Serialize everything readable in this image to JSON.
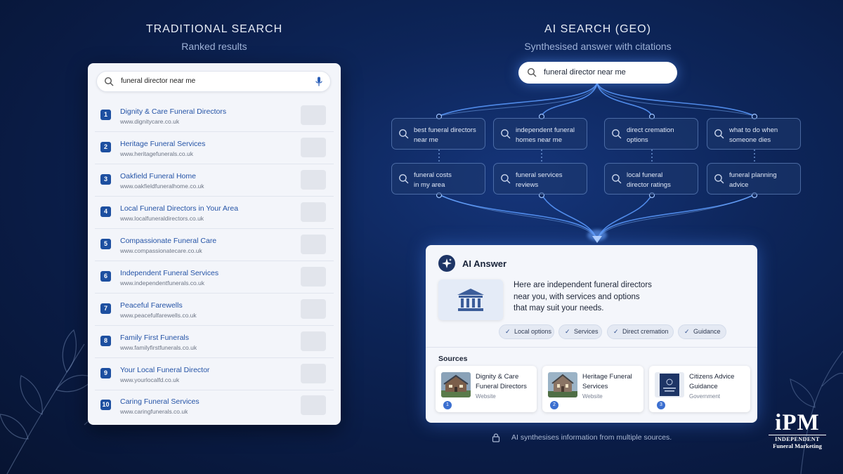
{
  "traditional": {
    "heading": "TRADITIONAL SEARCH",
    "subheading": "Ranked results",
    "search_query": "funeral director near me",
    "results": [
      {
        "rank": "1",
        "title": "Dignity & Care Funeral Directors",
        "url": "www.dignitycare.co.uk"
      },
      {
        "rank": "2",
        "title": "Heritage Funeral Services",
        "url": "www.heritagefunerals.co.uk"
      },
      {
        "rank": "3",
        "title": "Oakfield Funeral Home",
        "url": "www.oakfieldfuneralhome.co.uk"
      },
      {
        "rank": "4",
        "title": "Local Funeral Directors in Your Area",
        "url": "www.localfuneraldirectors.co.uk"
      },
      {
        "rank": "5",
        "title": "Compassionate Funeral Care",
        "url": "www.compassionatecare.co.uk"
      },
      {
        "rank": "6",
        "title": "Independent Funeral Services",
        "url": "www.independentfunerals.co.uk"
      },
      {
        "rank": "7",
        "title": "Peaceful Farewells",
        "url": "www.peacefulfarewells.co.uk"
      },
      {
        "rank": "8",
        "title": "Family First Funerals",
        "url": "www.familyfirstfunerals.co.uk"
      },
      {
        "rank": "9",
        "title": "Your Local Funeral Director",
        "url": "www.yourlocalfd.co.uk"
      },
      {
        "rank": "10",
        "title": "Caring Funeral Services",
        "url": "www.caringfunerals.co.uk"
      }
    ]
  },
  "ai": {
    "heading": "AI SEARCH (GEO)",
    "subheading": "Synthesised answer with citations",
    "search_query": "funeral director near me",
    "subqueries_row1": [
      {
        "l1": "best funeral directors",
        "l2": "near me"
      },
      {
        "l1": "independent funeral",
        "l2": "homes near me"
      },
      {
        "l1": "direct cremation",
        "l2": "options"
      },
      {
        "l1": "what to do when",
        "l2": "someone dies"
      }
    ],
    "subqueries_row2": [
      {
        "l1": "funeral costs",
        "l2": "in my area"
      },
      {
        "l1": "funeral services",
        "l2": "reviews"
      },
      {
        "l1": "local funeral",
        "l2": "director ratings"
      },
      {
        "l1": "funeral planning",
        "l2": "advice"
      }
    ],
    "answer_title": "AI Answer",
    "answer_lines": [
      "Here are independent funeral directors",
      "near you, with services and options",
      "that may suit your needs."
    ],
    "chips": [
      "Local options",
      "Services",
      "Direct cremation",
      "Guidance"
    ],
    "sources_label": "Sources",
    "sources": [
      {
        "l1": "Dignity & Care",
        "l2": "Funeral Directors",
        "type": "Website",
        "num": "1"
      },
      {
        "l1": "Heritage Funeral",
        "l2": "Services",
        "type": "Website",
        "num": "2"
      },
      {
        "l1": "Citizens Advice",
        "l2": "Guidance",
        "type": "Government",
        "num": "3"
      }
    ],
    "footnote": "AI synthesises information from multiple sources."
  },
  "logo": {
    "mark": "iPM",
    "line1": "INDEPENDENT",
    "line2": "Funeral Marketing"
  },
  "colors": {
    "accent": "#1d4fa0",
    "link": "#2453a6",
    "background": "#0d2559",
    "glow": "#5b9bff"
  }
}
